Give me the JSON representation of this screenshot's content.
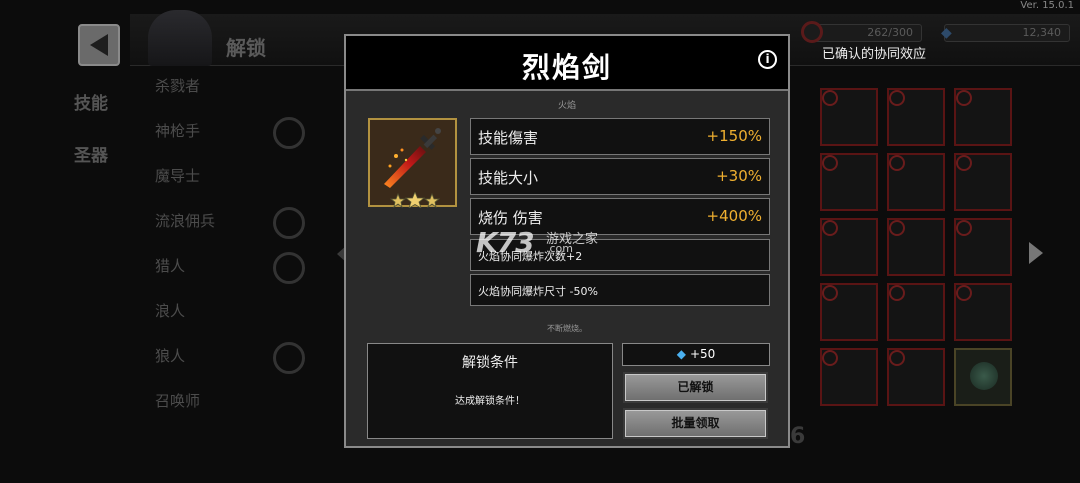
{
  "version": "Ver. 15.0.1",
  "header": {
    "title": "解锁",
    "resources": {
      "stamina": "262/300",
      "gems": "12,340"
    },
    "synergy_label": "已确认的协同效应"
  },
  "left_menu": {
    "tabs": [
      "技能",
      "圣器"
    ]
  },
  "class_list": [
    "杀戮者",
    "神枪手",
    "魔导士",
    "流浪佣兵",
    "猎人",
    "浪人",
    "狼人",
    "召唤师"
  ],
  "background_digit": "6",
  "modal": {
    "title": "烈焰剑",
    "element": "火焰",
    "item_stars": 3,
    "stats": [
      {
        "name": "技能傷害",
        "value": "+150%"
      },
      {
        "name": "技能大小",
        "value": "+30%"
      },
      {
        "name": "烧伤 伤害",
        "value": "+400%"
      }
    ],
    "sub_stats": [
      "火焰协同爆炸次数+2",
      "火焰协同爆炸尺寸 -50%"
    ],
    "description": "不断燃烧。",
    "unlock_condition": {
      "title": "解锁条件",
      "text": "达成解锁条件！"
    },
    "reward": "+50",
    "buttons": {
      "unlocked": "已解锁",
      "claim_all": "批量领取"
    }
  },
  "watermark": {
    "logo": "K73",
    "text": "游戏之家",
    "domain": ".com"
  },
  "colors": {
    "stat_value": "#f0b030",
    "item_border": "#b29240",
    "gem": "#4ab0f0"
  }
}
